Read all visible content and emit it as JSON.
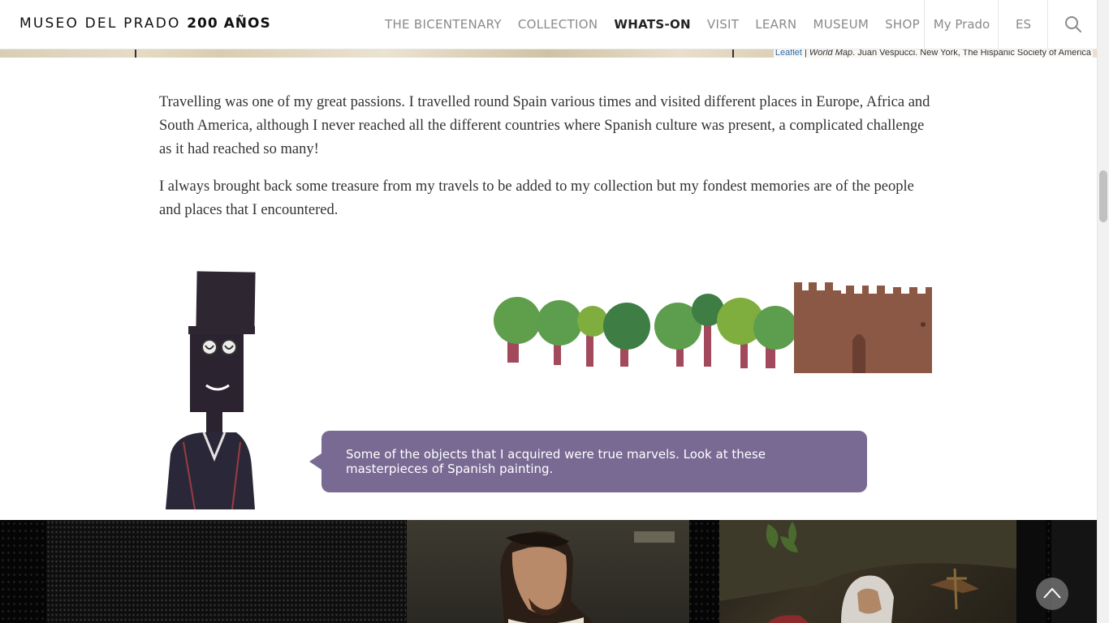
{
  "header": {
    "logo_main": "MUSEO DEL PRADO",
    "logo_year": "200 AÑOS",
    "nav": [
      {
        "label": "THE BICENTENARY",
        "active": false
      },
      {
        "label": "COLLECTION",
        "active": false
      },
      {
        "label": "WHATS-ON",
        "active": true
      },
      {
        "label": "VISIT",
        "active": false
      },
      {
        "label": "LEARN",
        "active": false
      },
      {
        "label": "MUSEUM",
        "active": false
      },
      {
        "label": "SHOP",
        "active": false
      }
    ],
    "my_prado": "My Prado",
    "language": "ES",
    "search_icon": "search-icon"
  },
  "map": {
    "attribution_link": "Leaflet",
    "attribution_sep": " | ",
    "attribution_title": "World Map",
    "attribution_rest": ". Juan Vespucci. New York, The Hispanic Society of America"
  },
  "text": {
    "paragraph1": "Travelling was one of my great passions. I travelled round Spain various times and visited different places in Europe, Africa and South America, although I never reached all the different countries where Spanish culture was present, a complicated challenge as it had reached so many!",
    "paragraph2": "I always brought back some treasure from my travels to be added to my collection but my fondest memories are of the people and places that I encountered."
  },
  "bubble": {
    "text": "Some of the objects that I acquired were true marvels. Look at these masterpieces of Spanish painting."
  },
  "colors": {
    "bubble": "#786a93",
    "nav_active": "#222222",
    "nav": "#8a8a8a"
  },
  "icons": {
    "back_to_top": "chevron-up-icon"
  }
}
